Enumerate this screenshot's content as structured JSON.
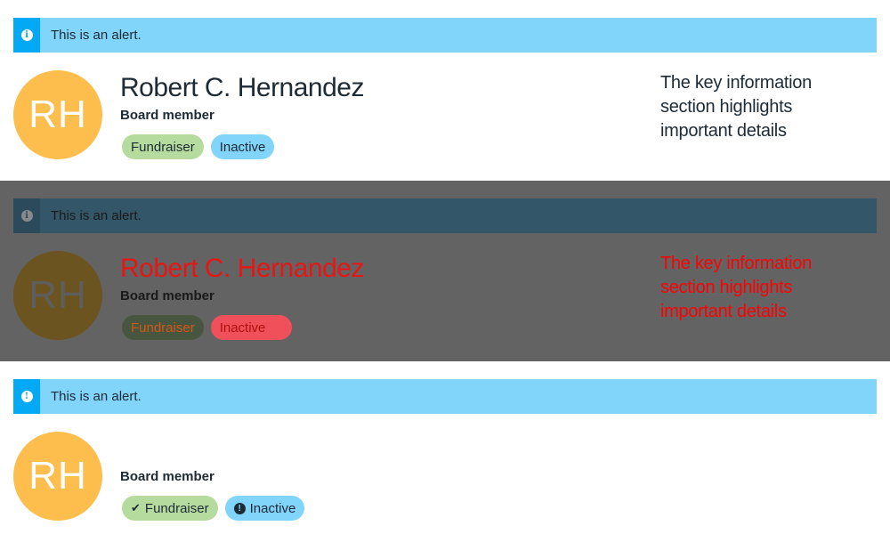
{
  "panels": [
    {
      "alert": {
        "text": "This is an alert.",
        "icon": "info-icon"
      },
      "avatar": {
        "initials": "RH"
      },
      "name": "Robert C. Hernandez",
      "role": "Board member",
      "tags": [
        {
          "label": "Fundraiser"
        },
        {
          "label": "Inactive"
        }
      ],
      "key_info": "The key information section highlights important details"
    },
    {
      "alert": {
        "text": "This is an alert."
      },
      "avatar": {
        "initials": "RH"
      },
      "name": "Robert C. Hernandez",
      "role": "Board member",
      "tags": [
        {
          "label": "Fundraiser"
        },
        {
          "label": "Inactive"
        }
      ],
      "key_info": "The key information section highlights important details"
    },
    {
      "alert": {
        "text": "This is an alert.",
        "icon": "exclamation-icon"
      },
      "avatar": {
        "initials": "RH"
      },
      "role": "Board member",
      "tags": [
        {
          "label": "Fundraiser",
          "icon": "check-icon"
        },
        {
          "label": "Inactive",
          "icon": "exclamation-circle-icon"
        }
      ]
    }
  ],
  "colors": {
    "alert_bg": "#81d4fa",
    "alert_icon_bg": "#03a9f4",
    "avatar_bg": "#fdbe4e",
    "tag_green": "#b6db9e",
    "tag_blue": "#81d4fa",
    "text": "#1d2b36",
    "overlay": "#636363",
    "highlight_red": "#ff0000"
  }
}
